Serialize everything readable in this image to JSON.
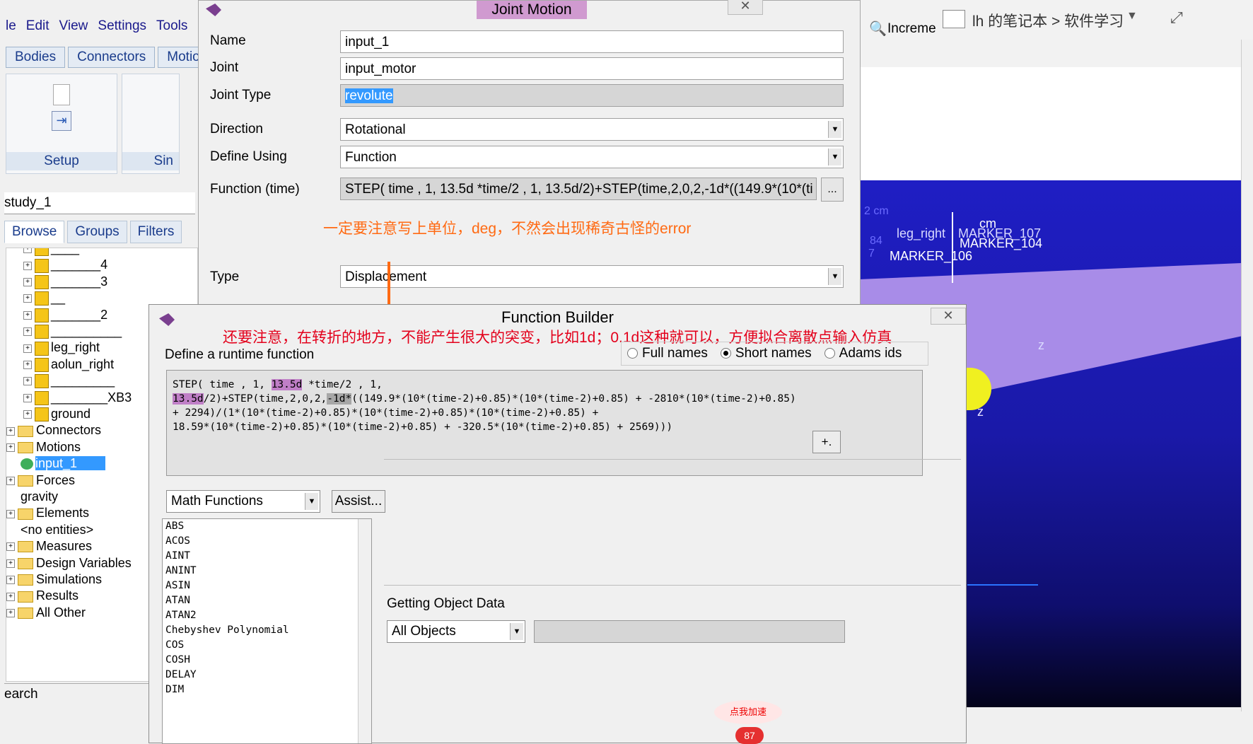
{
  "main_app": {
    "menu": [
      "le",
      "Edit",
      "View",
      "Settings",
      "Tools"
    ],
    "ribbon_tabs": [
      "Bodies",
      "Connectors",
      "Motio"
    ],
    "ribbon_groups": [
      {
        "label": "Setup"
      },
      {
        "label": "Sin"
      }
    ],
    "model_name": "study_1",
    "browse_tabs": [
      "Browse",
      "Groups",
      "Filters"
    ],
    "tree": [
      {
        "label": "____",
        "type": "body"
      },
      {
        "label": "_______4",
        "type": "body"
      },
      {
        "label": "_______3",
        "type": "body"
      },
      {
        "label": "__",
        "type": "body"
      },
      {
        "label": "_______2",
        "type": "body"
      },
      {
        "label": "__________",
        "type": "body"
      },
      {
        "label": "leg_right",
        "type": "body"
      },
      {
        "label": "aolun_right",
        "type": "body"
      },
      {
        "label": "_________",
        "type": "body"
      },
      {
        "label": "________XB3",
        "type": "body"
      },
      {
        "label": "ground",
        "type": "body"
      },
      {
        "label": "Connectors",
        "type": "folder"
      },
      {
        "label": "Motions",
        "type": "folder"
      },
      {
        "label": "input_1",
        "type": "motion",
        "selected": true
      },
      {
        "label": "Forces",
        "type": "folder"
      },
      {
        "label": "gravity",
        "type": "gravity"
      },
      {
        "label": "Elements",
        "type": "folder",
        "prefix": "ad2"
      },
      {
        "label": "<no entities>",
        "type": "leaf"
      },
      {
        "label": "Measures",
        "type": "folder"
      },
      {
        "label": "Design Variables",
        "type": "folder"
      },
      {
        "label": "Simulations",
        "type": "folder"
      },
      {
        "label": "Results",
        "type": "folder"
      },
      {
        "label": "All Other",
        "type": "folder"
      }
    ],
    "search_label": "earch"
  },
  "joint_motion": {
    "title": "Joint Motion",
    "fields": {
      "name_label": "Name",
      "name_value": "input_1",
      "joint_label": "Joint",
      "joint_value": "input_motor",
      "joint_type_label": "Joint Type",
      "joint_type_value": "revolute",
      "direction_label": "Direction",
      "direction_value": "Rotational",
      "define_using_label": "Define Using",
      "define_using_value": "Function",
      "function_label": "Function (time)",
      "function_value": "STEP( time , 1, 13.5d *time/2 , 1, 13.5d/2)+STEP(time,2,0,2,-1d*((149.9*(10*(ti",
      "dots_label": "...",
      "type_label": "Type",
      "type_value": "Displacement"
    },
    "note": "一定要注意写上单位，deg，不然会出现稀奇古怪的error"
  },
  "function_builder": {
    "title": "Function Builder",
    "note": "还要注意，在转折的地方，不能产生很大的突变，比如1d；0.1d这种就可以，方便拟合离散点输入仿真",
    "define_label": "Define a runtime function",
    "radio_options": [
      "Full names",
      "Short names",
      "Adams ids"
    ],
    "radio_selected": "Short names",
    "expression_lines": [
      [
        "STEP( time , 1, ",
        "13.5d",
        " *time/2 , 1,"
      ],
      [
        "13.5d",
        "/2)+STEP(time,2,0,2,",
        "-1d*",
        "((149.9*(10*(time-2)+0.85)*(10*(time-2)+0.85) + -2810*(10*(time-2)+0.85)"
      ],
      [
        "+ 2294)/(1*(10*(time-2)+0.85)*(10*(time-2)+0.85)*(10*(time-2)+0.85) +"
      ],
      [
        "18.59*(10*(time-2)+0.85)*(10*(time-2)+0.85) + -320.5*(10*(time-2)+0.85) + 2569)))"
      ]
    ],
    "category_value": "Math Functions",
    "assist_label": "Assist...",
    "plus_label": "+.",
    "functions": [
      "ABS",
      "ACOS",
      "AINT",
      "ANINT",
      "ASIN",
      "ATAN",
      "ATAN2",
      "Chebyshev Polynomial",
      "COS",
      "COSH",
      "DELAY",
      "DIM"
    ],
    "getting_object_label": "Getting Object Data",
    "object_filter_value": "All Objects"
  },
  "viewport": {
    "toolbar_text": "Increme",
    "onenote_path": "lh 的笔记本 > 软件学习",
    "labels": [
      "2 cm",
      "84",
      "leg_right",
      "MARKER_107",
      "cm",
      "MARKER_104",
      "7",
      "MARKER_106",
      "z",
      "z"
    ]
  },
  "overlay": {
    "accelerate_text": "点我加速",
    "badge_count": "87"
  }
}
